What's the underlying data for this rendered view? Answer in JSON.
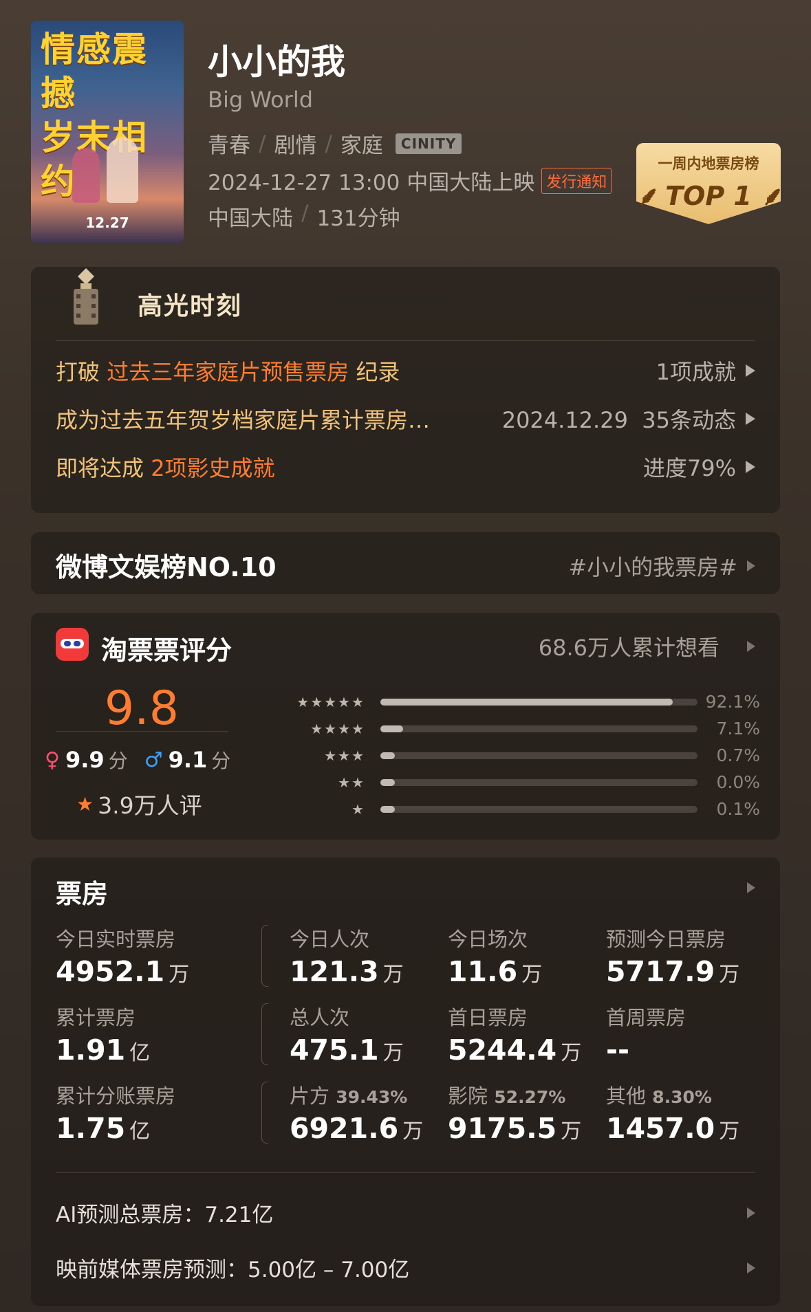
{
  "movie": {
    "poster_slogan_1": "情感震撼",
    "poster_slogan_2": "岁末相约",
    "poster_date": "12.27",
    "title": "小小的我",
    "subtitle": "Big World",
    "genres": [
      "青春",
      "剧情",
      "家庭"
    ],
    "format_badge": "CINITY",
    "release": "2024-12-27 13:00 中国大陆上映",
    "release_notice": "发行通知",
    "region": "中国大陆",
    "duration": "131分钟",
    "rank_badge": {
      "line1": "一周内地票房榜",
      "line2": "TOP 1"
    }
  },
  "highlights": {
    "title": "高光时刻",
    "rows": [
      {
        "prefix": "打破 ",
        "hot": "过去三年家庭片预售票房",
        "suffix": " 纪录",
        "right": "1项成就"
      },
      {
        "prefix": "成为过去五年贺岁档家庭片累计票房…",
        "hot": "",
        "suffix": "",
        "right": "2024.12.29  35条动态"
      },
      {
        "prefix": "即将达成 ",
        "hot": "2项影史成就",
        "suffix": "",
        "right": "进度79%"
      }
    ]
  },
  "weibo": {
    "label": "微博文娱榜NO.10",
    "tag": "#小小的我票房#"
  },
  "rating": {
    "title": "淘票票评分",
    "want": "68.6万人累计想看",
    "score": "9.8",
    "female_score": "9.9",
    "male_score": "9.1",
    "score_unit": "分",
    "raters": "3.9万人评",
    "distribution": [
      {
        "stars": "★★★★★",
        "percent": 92.1,
        "label": "92.1%"
      },
      {
        "stars": "★★★★",
        "percent": 7.1,
        "label": "7.1%"
      },
      {
        "stars": "★★★",
        "percent": 0.7,
        "label": "0.7%"
      },
      {
        "stars": "★★",
        "percent": 0.0,
        "label": "0.0%"
      },
      {
        "stars": "★",
        "percent": 0.1,
        "label": "0.1%"
      }
    ]
  },
  "box_office": {
    "title": "票房",
    "cells": [
      {
        "label": "今日实时票房",
        "pct": "",
        "value": "4952.1",
        "unit": "万"
      },
      {
        "label": "今日人次",
        "pct": "",
        "value": "121.3",
        "unit": "万"
      },
      {
        "label": "今日场次",
        "pct": "",
        "value": "11.6",
        "unit": "万"
      },
      {
        "label": "预测今日票房",
        "pct": "",
        "value": "5717.9",
        "unit": "万"
      },
      {
        "label": "累计票房",
        "pct": "",
        "value": "1.91",
        "unit": "亿"
      },
      {
        "label": "总人次",
        "pct": "",
        "value": "475.1",
        "unit": "万"
      },
      {
        "label": "首日票房",
        "pct": "",
        "value": "5244.4",
        "unit": "万"
      },
      {
        "label": "首周票房",
        "pct": "",
        "value": "--",
        "unit": ""
      },
      {
        "label": "累计分账票房",
        "pct": "",
        "value": "1.75",
        "unit": "亿"
      },
      {
        "label": "片方",
        "pct": "39.43%",
        "value": "6921.6",
        "unit": "万"
      },
      {
        "label": "影院",
        "pct": "52.27%",
        "value": "9175.5",
        "unit": "万"
      },
      {
        "label": "其他",
        "pct": "8.30%",
        "value": "1457.0",
        "unit": "万"
      }
    ],
    "ai_forecast": "AI预测总票房：7.21亿",
    "media_forecast": "映前媒体票房预测：5.00亿 – 7.00亿"
  }
}
